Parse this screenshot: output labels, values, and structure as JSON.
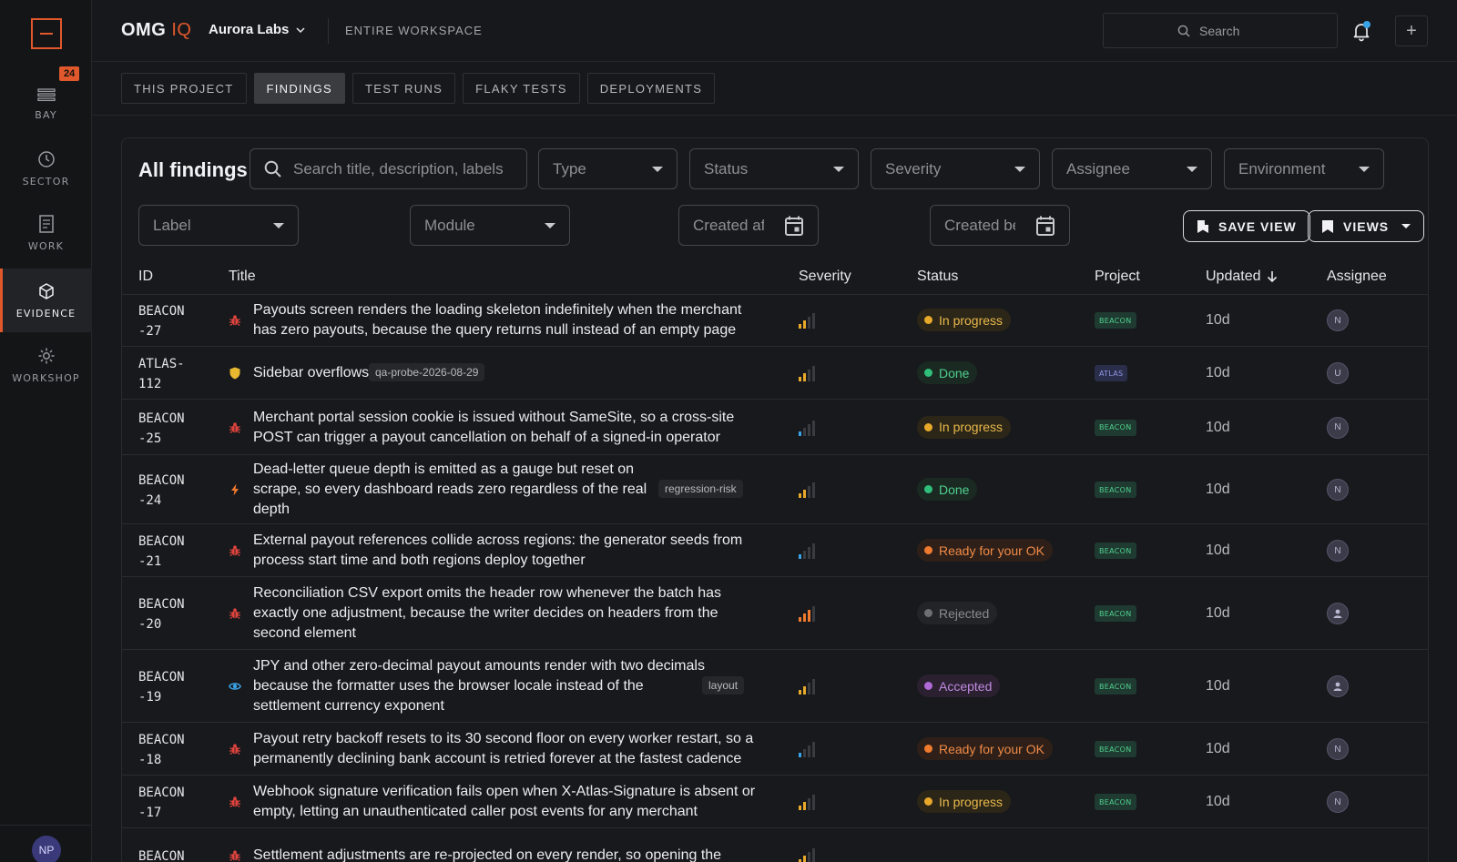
{
  "app": {
    "brand_main": "OMG",
    "brand_accent": "IQ",
    "workspace": "Aurora Labs",
    "scope": "ENTIRE WORKSPACE"
  },
  "top": {
    "search_placeholder": "Search"
  },
  "rail": {
    "items": [
      {
        "label": "BAY",
        "badge": "24"
      },
      {
        "label": "SECTOR"
      },
      {
        "label": "WORK"
      },
      {
        "label": "EVIDENCE",
        "active": true
      },
      {
        "label": "WORKSHOP"
      }
    ],
    "user_initials": "NP"
  },
  "tabs": [
    "THIS PROJECT",
    "FINDINGS",
    "TEST RUNS",
    "FLAKY TESTS",
    "DEPLOYMENTS"
  ],
  "active_tab": "FINDINGS",
  "filters": {
    "title": "All findings",
    "search_placeholder": "Search title, description, labels",
    "type": "Type",
    "status": "Status",
    "severity": "Severity",
    "assignee": "Assignee",
    "environment": "Environment",
    "label": "Label",
    "module": "Module",
    "created_after": "Created after",
    "created_before": "Created before",
    "save_view": "SAVE VIEW",
    "views": "VIEWS"
  },
  "columns": {
    "id": "ID",
    "title": "Title",
    "severity": "Severity",
    "status": "Status",
    "project": "Project",
    "updated": "Updated",
    "assignee": "Assignee"
  },
  "rows": [
    {
      "id_a": "BEACON",
      "id_b": "-27",
      "title_lines": [
        "Payouts screen renders the loading skeleton indefinitely when the merchant",
        "has zero payouts, because the query returns null instead of an empty page"
      ],
      "icon": "bug-icon",
      "tag": "",
      "severity_level": 2,
      "status": "In progress",
      "project": "BEACON",
      "updated": "10d",
      "assignee": "N"
    },
    {
      "id_a": "ATLAS-",
      "id_b": "112",
      "title_lines": [
        "Sidebar overflows"
      ],
      "icon": "shield-icon",
      "tag": "qa-probe-2026-08-29",
      "severity_level": 2,
      "status": "Done",
      "project": "ATLAS",
      "updated": "10d",
      "assignee": "U"
    },
    {
      "id_a": "BEACON",
      "id_b": "-25",
      "title_lines": [
        "Merchant portal session cookie is issued without SameSite, so a cross-site",
        "POST can trigger a payout cancellation on behalf of a signed-in operator"
      ],
      "icon": "bug-icon",
      "tag": "",
      "severity_level": 1,
      "status": "In progress",
      "project": "BEACON",
      "updated": "10d",
      "assignee": "N"
    },
    {
      "id_a": "BEACON",
      "id_b": "-24",
      "title_lines": [
        "Dead-letter queue depth is emitted as a gauge but reset on",
        "scrape, so every dashboard reads zero regardless of the real",
        "depth"
      ],
      "icon": "bolt-icon",
      "tag": "regression-risk",
      "severity_level": 2,
      "status": "Done",
      "project": "BEACON",
      "updated": "10d",
      "assignee": "N"
    },
    {
      "id_a": "BEACON",
      "id_b": "-21",
      "title_lines": [
        "External payout references collide across regions: the generator seeds from",
        "process start time and both regions deploy together"
      ],
      "icon": "bug-icon",
      "tag": "",
      "severity_level": 1,
      "status": "Ready for your OK",
      "project": "BEACON",
      "updated": "10d",
      "assignee": "N"
    },
    {
      "id_a": "BEACON",
      "id_b": "-20",
      "title_lines": [
        "Reconciliation CSV export omits the header row whenever the batch has",
        "exactly one adjustment, because the writer decides on headers from the",
        "second element"
      ],
      "icon": "bug-icon",
      "tag": "",
      "severity_level": 3,
      "status": "Rejected",
      "project": "BEACON",
      "updated": "10d",
      "assignee": ""
    },
    {
      "id_a": "BEACON",
      "id_b": "-19",
      "title_lines": [
        "JPY and other zero-decimal payout amounts render with two decimals",
        "because the formatter uses the browser locale instead of the",
        "settlement currency exponent"
      ],
      "icon": "eye-icon",
      "tag": "layout",
      "severity_level": 2,
      "status": "Accepted",
      "project": "BEACON",
      "updated": "10d",
      "assignee": ""
    },
    {
      "id_a": "BEACON",
      "id_b": "-18",
      "title_lines": [
        "Payout retry backoff resets to its 30 second floor on every worker restart, so a",
        "permanently declining bank account is retried forever at the fastest cadence"
      ],
      "icon": "bug-icon",
      "tag": "",
      "severity_level": 1,
      "status": "Ready for your OK",
      "project": "BEACON",
      "updated": "10d",
      "assignee": "N"
    },
    {
      "id_a": "BEACON",
      "id_b": "-17",
      "title_lines": [
        "Webhook signature verification fails open when X-Atlas-Signature is absent or",
        "empty, letting an unauthenticated caller post events for any merchant"
      ],
      "icon": "bug-icon",
      "tag": "",
      "severity_level": 2,
      "status": "In progress",
      "project": "BEACON",
      "updated": "10d",
      "assignee": "N"
    },
    {
      "id_a": "BEACON",
      "id_b": "",
      "title_lines": [
        "Settlement adjustments are re-projected on every render, so opening the"
      ],
      "icon": "bug-icon",
      "tag": "",
      "severity_level": 2,
      "status": "",
      "project": "",
      "updated": "",
      "assignee": ""
    }
  ],
  "status_colors": {
    "In progress": {
      "dot": "#e8a92a",
      "text": "#e8b84a",
      "bg": "#2c2618"
    },
    "Done": {
      "dot": "#2fbf7a",
      "text": "#4fd08f",
      "bg": "#1a2a22"
    },
    "Ready for your OK": {
      "dot": "#f07a2e",
      "text": "#f08a46",
      "bg": "#2e2019"
    },
    "Rejected": {
      "dot": "#6e6f74",
      "text": "#8a8b90",
      "bg": "#232427"
    },
    "Accepted": {
      "dot": "#b06ad8",
      "text": "#c08ae0",
      "bg": "#2a2030"
    }
  },
  "project_colors": {
    "BEACON": {
      "bg": "#1f3a30",
      "text": "#4fd08f"
    },
    "ATLAS": {
      "bg": "#2a2e4a",
      "text": "#8f98e8"
    }
  },
  "icon_colors": {
    "bug-icon": "#e0443e",
    "shield-icon": "#e8b830",
    "bolt-icon": "#f07a2e",
    "eye-icon": "#3aa3e8"
  },
  "severity_colors": {
    "1": "#3aa3e8",
    "2": "#e8a92a",
    "3": "#f07a2e"
  }
}
